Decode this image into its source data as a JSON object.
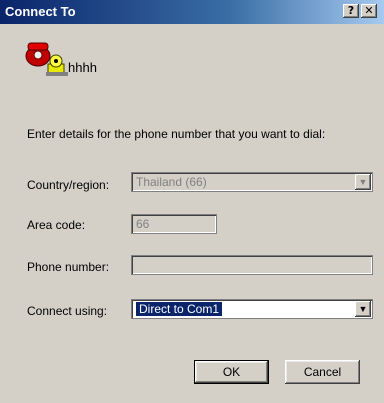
{
  "window": {
    "title": "Connect To",
    "help_label": "?",
    "close_label": "✕"
  },
  "connection": {
    "name": "hhhh",
    "icon": "phone-icon"
  },
  "instructions": "Enter details for the phone number that you want to dial:",
  "fields": {
    "country": {
      "label": "Country/region:",
      "value": "Thailand (66)"
    },
    "area_code": {
      "label": "Area code:",
      "value": "66"
    },
    "phone_number": {
      "label": "Phone number:",
      "value": ""
    },
    "connect_using": {
      "label": "Connect using:",
      "value": "Direct to Com1"
    }
  },
  "buttons": {
    "ok": "OK",
    "cancel": "Cancel"
  }
}
